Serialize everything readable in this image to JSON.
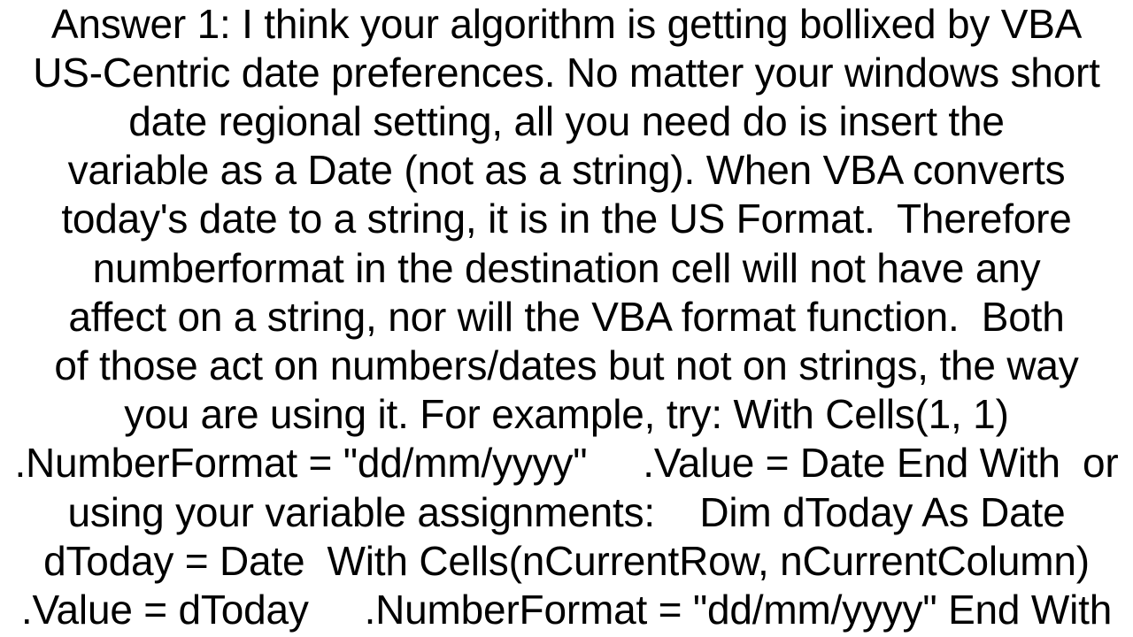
{
  "document": {
    "lines": [
      "Answer 1: I think your algorithm is getting bollixed by VBA",
      "US-Centric date preferences. No matter your windows short",
      "date regional setting, all you need do is insert the",
      "variable as a Date (not as a string). When VBA converts",
      "today's date to a string, it is in the US Format.  Therefore",
      "numberformat in the destination cell will not have any",
      "affect on a string, nor will the VBA format function.  Both",
      "of those act on numbers/dates but not on strings, the way",
      "you are using it. For example, try: With Cells(1, 1)",
      ".NumberFormat = \"dd/mm/yyyy\"     .Value = Date End With  or",
      "using your variable assignments:    Dim dToday As Date",
      "dToday = Date  With Cells(nCurrentRow, nCurrentColumn)",
      ".Value = dToday     .NumberFormat = \"dd/mm/yyyy\" End With"
    ]
  }
}
